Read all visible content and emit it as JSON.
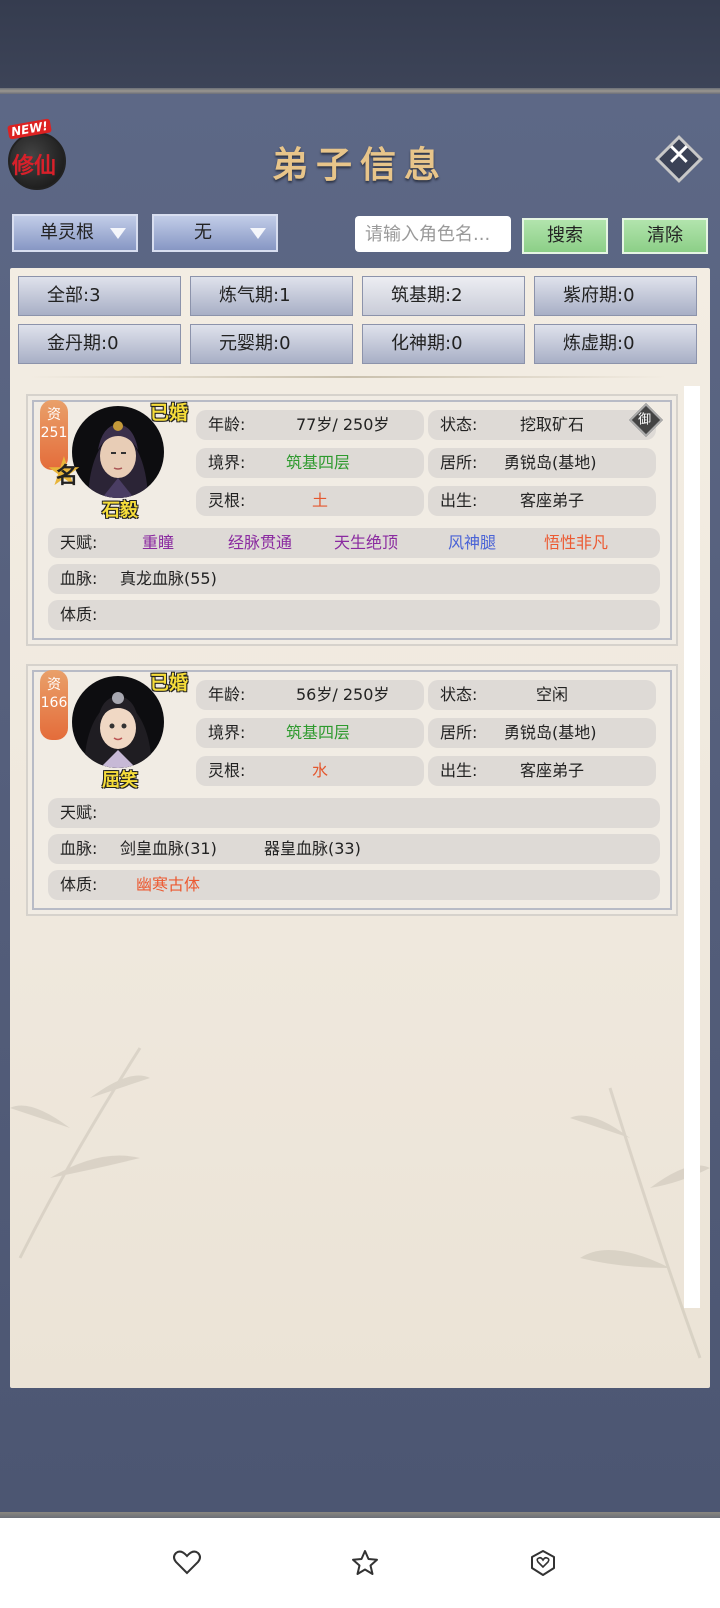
{
  "header": {
    "title": "弟子信息",
    "badge_new": "NEW!",
    "badge_text": "修仙"
  },
  "filters": {
    "dropdown1": "单灵根",
    "dropdown2": "无",
    "search_placeholder": "请输入角色名...",
    "search_label": "搜索",
    "clear_label": "清除"
  },
  "tabs": [
    "全部:3",
    "炼气期:1",
    "筑基期:2",
    "紫府期:0",
    "金丹期:0",
    "元婴期:0",
    "化神期:0",
    "炼虚期:0"
  ],
  "labels": {
    "age": "年龄:",
    "status": "状态:",
    "realm": "境界:",
    "residence": "居所:",
    "root": "灵根:",
    "birth": "出生:",
    "talent": "天赋:",
    "bloodline": "血脉:",
    "physique": "体质:",
    "aptitude": "资",
    "married": "已婚",
    "famous": "名",
    "yu": "御"
  },
  "disciples": [
    {
      "name": "石毅",
      "aptitude": "251",
      "age": "77岁/ 250岁",
      "status": "挖取矿石",
      "realm": "筑基四层",
      "residence": "勇锐岛(基地)",
      "root": "土",
      "birth": "客座弟子",
      "talents": [
        "重瞳",
        "经脉贯通",
        "天生绝顶",
        "风神腿",
        "悟性非凡"
      ],
      "bloodlines": [
        "真龙血脉(55)"
      ],
      "physique": ""
    },
    {
      "name": "屈笑",
      "aptitude": "166",
      "age": "56岁/ 250岁",
      "status": "空闲",
      "realm": "筑基四层",
      "residence": "勇锐岛(基地)",
      "root": "水",
      "birth": "客座弟子",
      "talents": [],
      "bloodlines": [
        "剑皇血脉(31)",
        "器皇血脉(33)"
      ],
      "physique": "幽寒古体"
    }
  ],
  "colors": {
    "realm": "#2e9a2e",
    "root": "#e4572e",
    "talent_purple": "#8a2aa0",
    "talent_blue": "#4a63d6",
    "talent_orange": "#ec5a32",
    "physique": "#ec5a32",
    "name_yellow": "#f6dd3a"
  },
  "navbar": {
    "icons": [
      "heart-icon",
      "star-icon",
      "heart-shield-icon"
    ]
  }
}
